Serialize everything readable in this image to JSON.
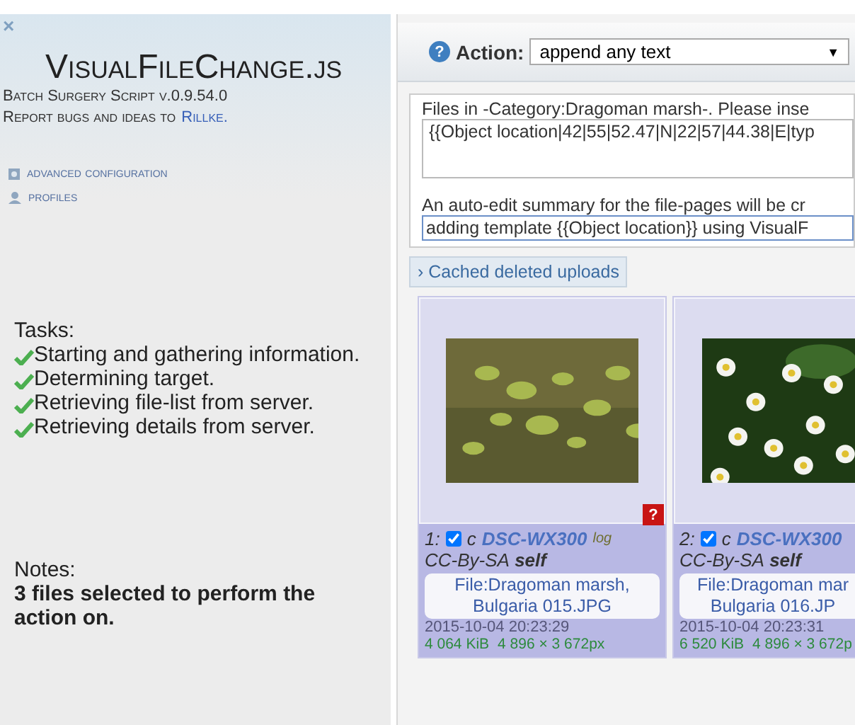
{
  "sidebar": {
    "close": "×",
    "title": "VisualFileChange.js",
    "version": "Batch Surgery Script v.0.9.54.0",
    "report": "Report bugs and ideas to",
    "author": "Rillke.",
    "links": [
      {
        "kind": "config",
        "label": "advanced configuration"
      },
      {
        "kind": "profiles",
        "label": "profiles"
      }
    ],
    "tasks_label": "Tasks:",
    "tasks": [
      {
        "label": "Starting and gathering information.",
        "done": true
      },
      {
        "label": "Determining target.",
        "done": true
      },
      {
        "label": "Retrieving file-list from server.",
        "done": true
      },
      {
        "label": "Retrieving details from server.",
        "done": true
      }
    ],
    "notes_label": "Notes:",
    "notes": "3 files selected to perform the action on."
  },
  "action": {
    "help": "?",
    "label": "Action:",
    "value": "append any text",
    "arrow": "▼"
  },
  "files_intro": "Files in -Category:Dragoman marsh-. Please inse",
  "text_value": "{{Object location|42|55|52.47|N|22|57|44.38|E|typ",
  "summary_intro": "An auto-edit summary for the file-pages will be cr",
  "summary_value": "adding template {{Object location}} using VisualF",
  "cached_button": "› Cached deleted uploads",
  "files": [
    {
      "kind": "marsh",
      "badge": "?",
      "index": "1:",
      "checked": true,
      "c": "c",
      "camera": "DSC-WX300",
      "tag": "log",
      "license": "CC-By-SA",
      "author": "self",
      "name": [
        "File:Dragoman marsh,",
        "Bulgaria 015.JPG"
      ],
      "date": "2015-10-04 20:23:29",
      "size": "4 064 KiB",
      "dims": "4 896 × 3 672px"
    },
    {
      "kind": "daisies",
      "index": "2:",
      "checked": true,
      "c": "c",
      "camera": "DSC-WX300",
      "license": "CC-By-SA",
      "author": "self",
      "name": [
        "File:Dragoman mar",
        "Bulgaria 016.JP"
      ],
      "date": "2015-10-04 20:23:31",
      "size": "6 520 KiB",
      "dims": "4 896 × 3 672p"
    }
  ]
}
